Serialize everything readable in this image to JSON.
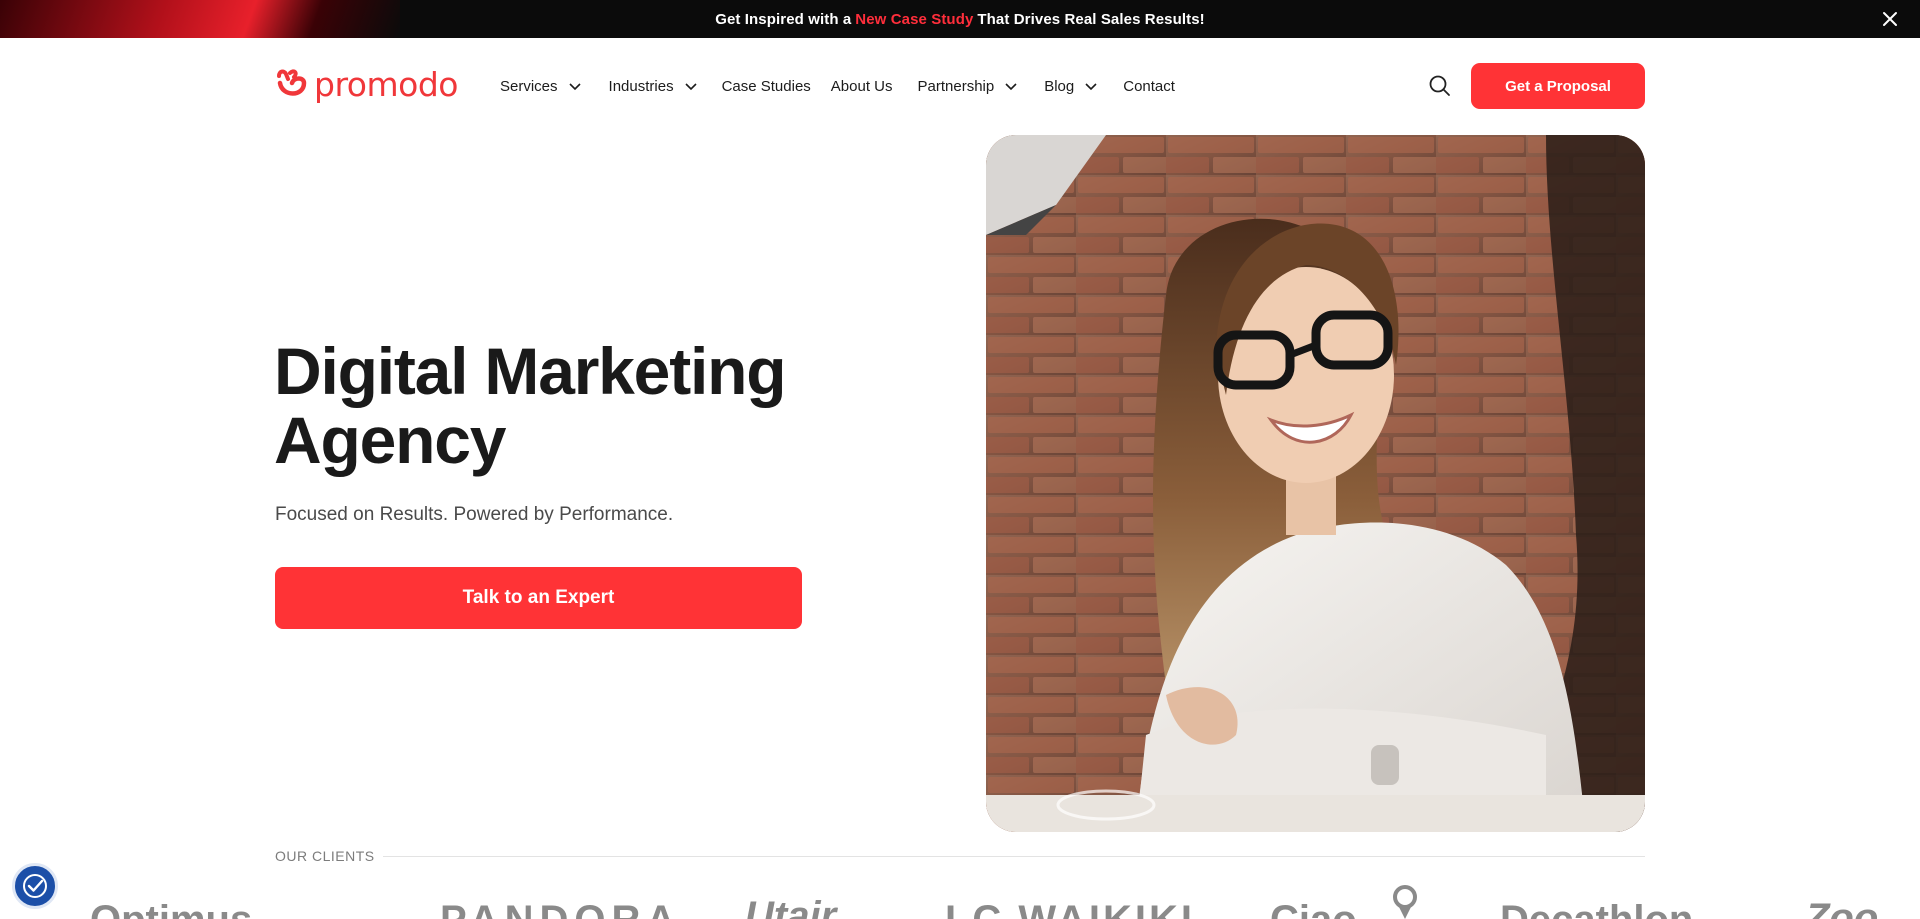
{
  "promo": {
    "text_before": "Get Inspired with a",
    "link_text": "New Case Study",
    "text_after": "That Drives Real Sales Results!",
    "close_icon": "close-icon",
    "accent_color": "#ff2e3b"
  },
  "header": {
    "logo_text": "promodo",
    "nav": [
      {
        "label": "Services",
        "has_dropdown": true
      },
      {
        "label": "Industries",
        "has_dropdown": true
      },
      {
        "label": "Case Studies",
        "has_dropdown": false
      },
      {
        "label": "About Us",
        "has_dropdown": false
      },
      {
        "label": "Partnership",
        "has_dropdown": true
      },
      {
        "label": "Blog",
        "has_dropdown": true
      },
      {
        "label": "Contact",
        "has_dropdown": false
      }
    ],
    "search_icon": "search-icon",
    "cta_label": "Get a Proposal"
  },
  "hero": {
    "title_line1": "Digital Marketing",
    "title_line2": "Agency",
    "subtitle": "Focused on Results. Powered by Performance.",
    "cta_label": "Talk to an Expert"
  },
  "clients": {
    "label": "OUR CLIENTS",
    "logos": [
      "Optimus",
      "PANDORA",
      "Utair",
      "LC WAIKIKI",
      "Ciao",
      "pin-logo",
      "Decathlon",
      "Zoo"
    ]
  },
  "colors": {
    "brand": "#ff3336",
    "text": "#1a1a1a",
    "accessibility_button": "#1c4fa8"
  },
  "accessibility": {
    "icon": "accessibility-icon"
  }
}
